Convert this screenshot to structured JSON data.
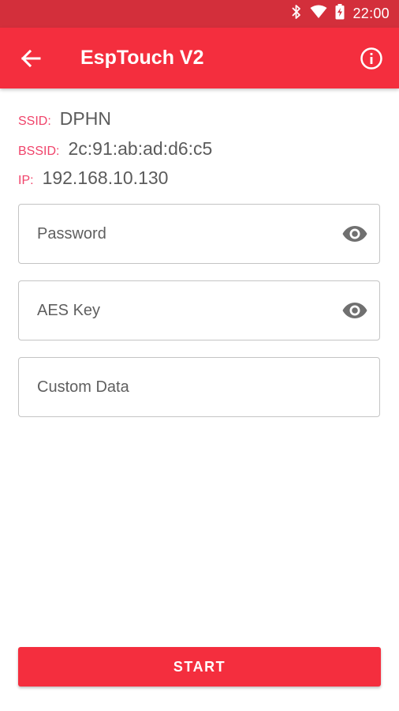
{
  "status_bar": {
    "time": "22:00",
    "icons": [
      "bluetooth-icon",
      "wifi-icon",
      "battery-charging-icon"
    ]
  },
  "app_bar": {
    "title": "EspTouch V2",
    "back_icon": "arrow-back-icon",
    "info_icon": "info-icon",
    "color": "#f42e3e"
  },
  "network": {
    "ssid_label": "SSID:",
    "ssid_value": "DPHN",
    "bssid_label": "BSSID:",
    "bssid_value": "2c:91:ab:ad:d6:c5",
    "ip_label": "IP:",
    "ip_value": "192.168.10.130"
  },
  "form": {
    "password_placeholder": "Password",
    "aes_key_placeholder": "AES Key",
    "custom_data_placeholder": "Custom Data"
  },
  "actions": {
    "start_label": "START"
  }
}
